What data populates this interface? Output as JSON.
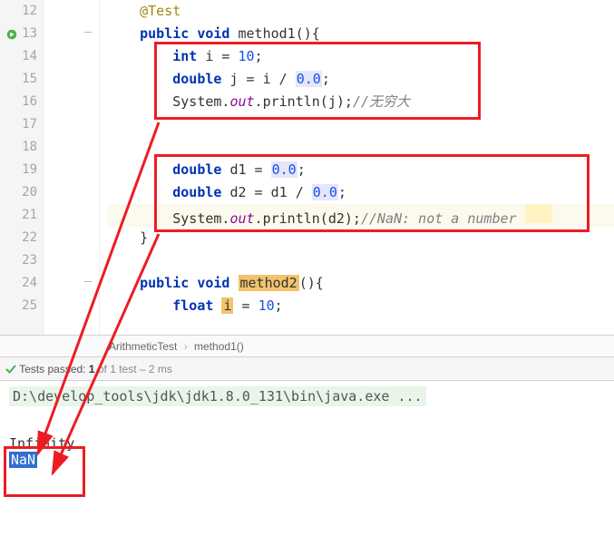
{
  "editor": {
    "lines": {
      "12": {
        "annotation": "@Test"
      },
      "13": {
        "kw1": "public",
        "kw2": "void",
        "ident": "method1",
        "rest": "(){"
      },
      "14": {
        "kw1": "int",
        "rest": " i = ",
        "num": "10",
        "semi": ";"
      },
      "15": {
        "kw1": "double",
        "rest": " j = i / ",
        "num": "0.0",
        "semi": ";"
      },
      "16": {
        "sys": "System.",
        "out": "out",
        "rest": ".println(j);",
        "cmt": "//无穷大"
      },
      "17": {},
      "18": {},
      "19": {
        "kw1": "double",
        "rest": " d1 = ",
        "num": "0.0",
        "semi": ";"
      },
      "20": {
        "kw1": "double",
        "rest": " d2 = d1 / ",
        "num": "0.0",
        "semi": ";"
      },
      "21": {
        "sys": "System.",
        "out": "out",
        "rest": ".println(d2);",
        "cmt": "//NaN: not a number"
      },
      "22": {
        "brace": "}"
      },
      "23": {},
      "24": {
        "kw1": "public",
        "kw2": "void",
        "ident": "method2",
        "rest": "(){"
      },
      "25": {
        "kw1": "float",
        "rest": " ",
        "ident2": "i",
        "rest2": " = ",
        "num": "10",
        "semi": ";"
      }
    },
    "line_numbers": [
      "12",
      "13",
      "14",
      "15",
      "16",
      "17",
      "18",
      "19",
      "20",
      "21",
      "22",
      "23",
      "24",
      "25"
    ]
  },
  "breadcrumb": {
    "class": "ArithmeticTest",
    "method": "method1()"
  },
  "test_bar": {
    "prefix": "Tests passed:",
    "count": "1",
    "mid": "of 1 test –",
    "time": "2 ms"
  },
  "console": {
    "cmd": "D:\\develop_tools\\jdk\\jdk1.8.0_131\\bin\\java.exe ...",
    "out1": "Infinity",
    "out2": "NaN"
  }
}
